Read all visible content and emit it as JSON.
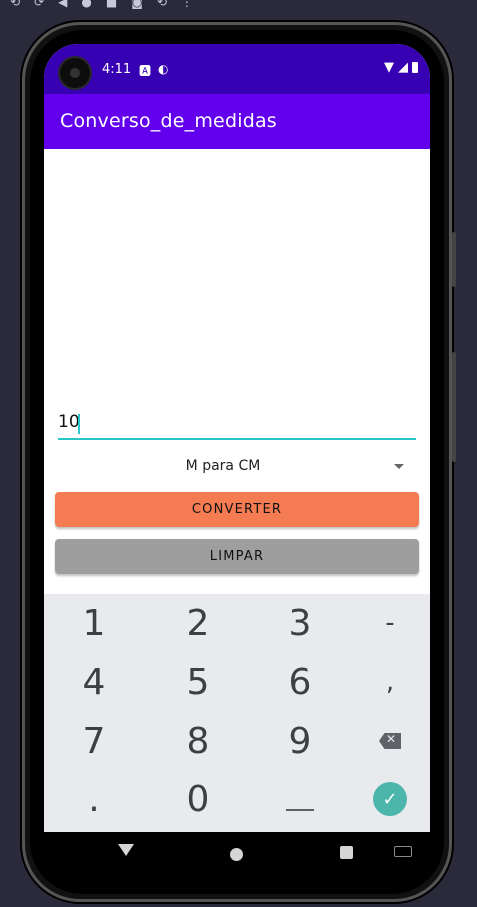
{
  "status_bar": {
    "time": "4:11"
  },
  "app_bar": {
    "title": "Converso_de_medidas"
  },
  "form": {
    "value": "10",
    "conversion_selected": "M para CM",
    "convert_label": "CONVERTER",
    "clear_label": "LIMPAR"
  },
  "keyboard": {
    "rows": [
      [
        "1",
        "2",
        "3",
        "-"
      ],
      [
        "4",
        "5",
        "6",
        ","
      ],
      [
        "7",
        "8",
        "9",
        "backspace"
      ],
      [
        ".",
        "0",
        "_",
        "done"
      ]
    ]
  },
  "colors": {
    "status_bar": "#3700b3",
    "app_bar": "#6200ee",
    "convert_button": "#f47b52",
    "clear_button": "#9e9e9e",
    "input_underline": "#26c6c6",
    "done_key": "#4db6ac"
  },
  "icons": {
    "status": [
      "notification-a-icon",
      "notification-p-icon",
      "wifi-icon",
      "signal-icon",
      "battery-icon"
    ],
    "nav": [
      "back-icon",
      "home-icon",
      "recents-icon",
      "keyboard-icon"
    ]
  }
}
